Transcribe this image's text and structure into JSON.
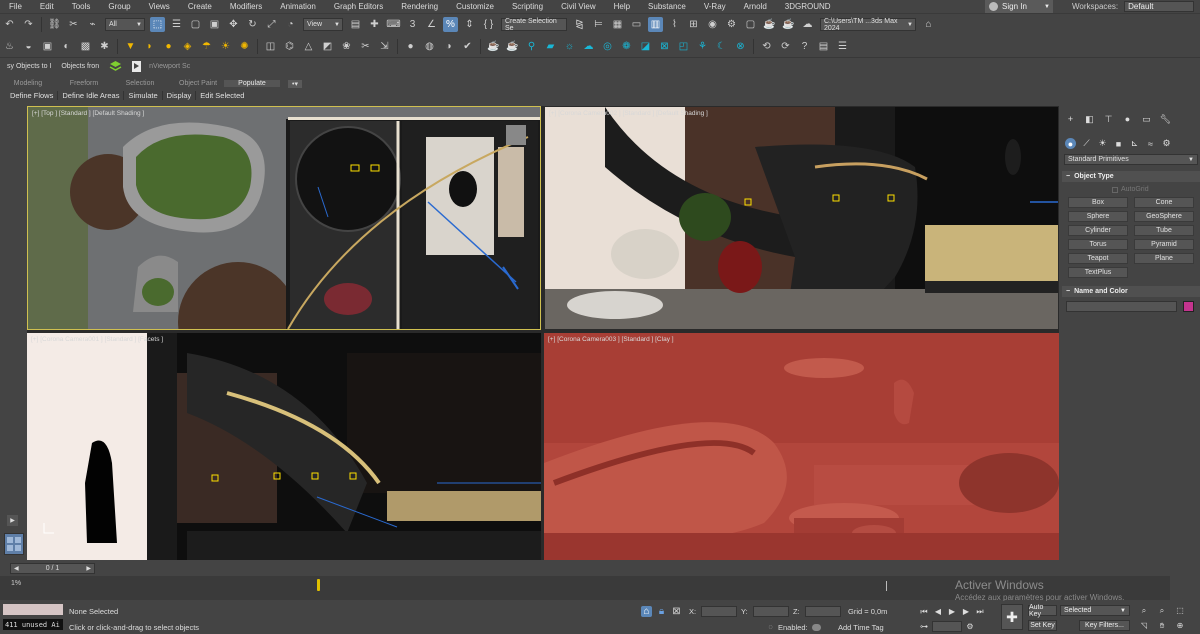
{
  "menu": [
    "File",
    "Edit",
    "Tools",
    "Group",
    "Views",
    "Create",
    "Modifiers",
    "Animation",
    "Graph Editors",
    "Rendering",
    "Customize",
    "Scripting",
    "Civil View",
    "Help",
    "Substance",
    "V-Ray",
    "Arnold",
    "3DGROUND"
  ],
  "signin": "Sign In",
  "workspaces_label": "Workspaces:",
  "workspaces_value": "Default",
  "toolbar": {
    "filter_select": "All",
    "refcoord_select": "View",
    "selection_set": "Create Selection Se",
    "path": "C:\\Users\\TM ...3ds Max 2024"
  },
  "ribbon": {
    "ribbon_btn1": "sy Objects to I",
    "ribbon_btn2": "Objects fron",
    "viewport_field": "nViewport Sc",
    "tabs": [
      "Modeling",
      "Freeform",
      "Selection",
      "Object Paint",
      "Populate"
    ],
    "active_tab": "Populate",
    "actions": [
      "Define Flows",
      "Define Idle Areas",
      "Simulate",
      "Display",
      "Edit Selected"
    ]
  },
  "viewports": [
    {
      "label": "[+] [Top ] [Standard ] [Default Shading ]"
    },
    {
      "label": "[+] [Corona Camera002 ] [Standard ] [Default Shading ]"
    },
    {
      "label": "[+] [Corona Camera001 ] [Standard ] [Facets ]"
    },
    {
      "label": "[+] [Corona Camera003 ] [Standard ] [Clay ]"
    }
  ],
  "command_panel": {
    "category_dropdown": "Standard Primitives",
    "object_type_title": "Object Type",
    "autogrid": "AutoGrid",
    "objects": [
      "Box",
      "Cone",
      "Sphere",
      "GeoSphere",
      "Cylinder",
      "Tube",
      "Torus",
      "Pyramid",
      "Teapot",
      "Plane",
      "TextPlus"
    ],
    "name_color_title": "Name and Color",
    "swatch_color": "#c4348e"
  },
  "timeline": {
    "slider_value": "0 / 1",
    "track_start": "1%"
  },
  "activate": {
    "title": "Activer Windows",
    "subtitle": "Accédez aux paramètres pour activer Windows."
  },
  "status": {
    "listener": "411 unused Ai",
    "selection": "None Selected",
    "prompt": "Click or click-and-drag to select objects",
    "x_label": "X:",
    "y_label": "Y:",
    "z_label": "Z:",
    "grid": "Grid = 0,0m",
    "enabled": "Enabled:",
    "add_time_tag": "Add Time Tag",
    "auto_key": "Auto Key",
    "set_key": "Set Key",
    "selected": "Selected",
    "key_filters": "Key Filters..."
  }
}
